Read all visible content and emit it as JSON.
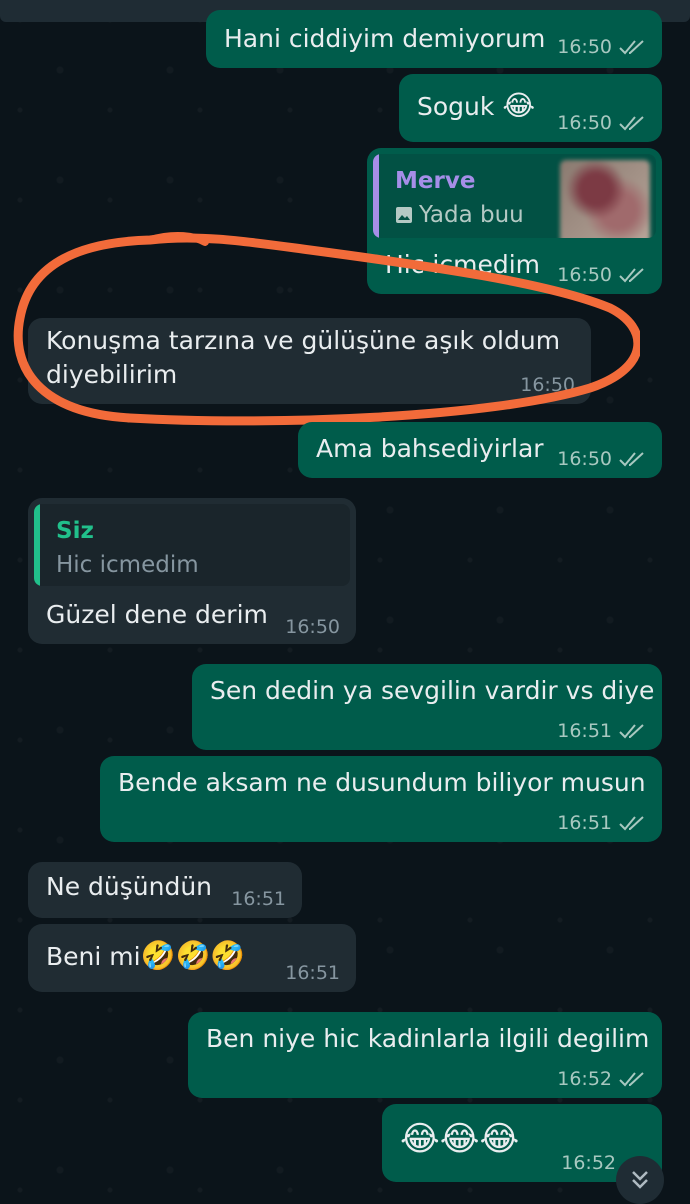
{
  "colors": {
    "background": "#0b141a",
    "outgoing_bubble": "#005c4b",
    "incoming_bubble": "#202c33",
    "highlight_circle": "#f26b3a",
    "reply_name_merve": "#a68ee8",
    "reply_name_siz": "#21c08b"
  },
  "messages": [
    {
      "id": 0,
      "direction": "out",
      "text": "Hani ciddiyim demiyorum",
      "time": "16:50",
      "status": "read"
    },
    {
      "id": 1,
      "direction": "out",
      "text": "Soguk",
      "emoji": "😂",
      "time": "16:50",
      "status": "read"
    },
    {
      "id": 2,
      "direction": "out",
      "reply_to": {
        "name": "Merve",
        "text": "Yada buu",
        "icon": "image-icon"
      },
      "text": "Hic icmedim",
      "time": "16:50",
      "status": "read"
    },
    {
      "id": 3,
      "direction": "in",
      "text_line1": "Konuşma tarzına ve gülüşüne aşık oldum",
      "text_line2": "diyebilirim",
      "time": "16:50",
      "highlighted": true
    },
    {
      "id": 4,
      "direction": "out",
      "text": "Ama bahsediyirlar",
      "time": "16:50",
      "status": "read"
    },
    {
      "id": 5,
      "direction": "in",
      "reply_to": {
        "name": "Siz",
        "text": "Hic icmedim"
      },
      "text": "Güzel dene derim",
      "time": "16:50"
    },
    {
      "id": 6,
      "direction": "out",
      "text": "Sen dedin ya sevgilin vardir vs diye",
      "time": "16:51",
      "status": "read"
    },
    {
      "id": 7,
      "direction": "out",
      "text": "Bende aksam ne dusundum biliyor musun",
      "time": "16:51",
      "status": "read"
    },
    {
      "id": 8,
      "direction": "in",
      "text": "Ne düşündün",
      "time": "16:51"
    },
    {
      "id": 9,
      "direction": "in",
      "text": "Beni mi",
      "emoji": "🤣🤣🤣",
      "time": "16:51"
    },
    {
      "id": 10,
      "direction": "out",
      "text": "Ben niye hic kadinlarla ilgili degilim",
      "time": "16:52",
      "status": "read"
    },
    {
      "id": 11,
      "direction": "out",
      "emoji": "😂😂😂",
      "time": "16:52",
      "status": "read"
    }
  ],
  "scroll_button": {
    "icon": "double-chevron-down-icon"
  }
}
